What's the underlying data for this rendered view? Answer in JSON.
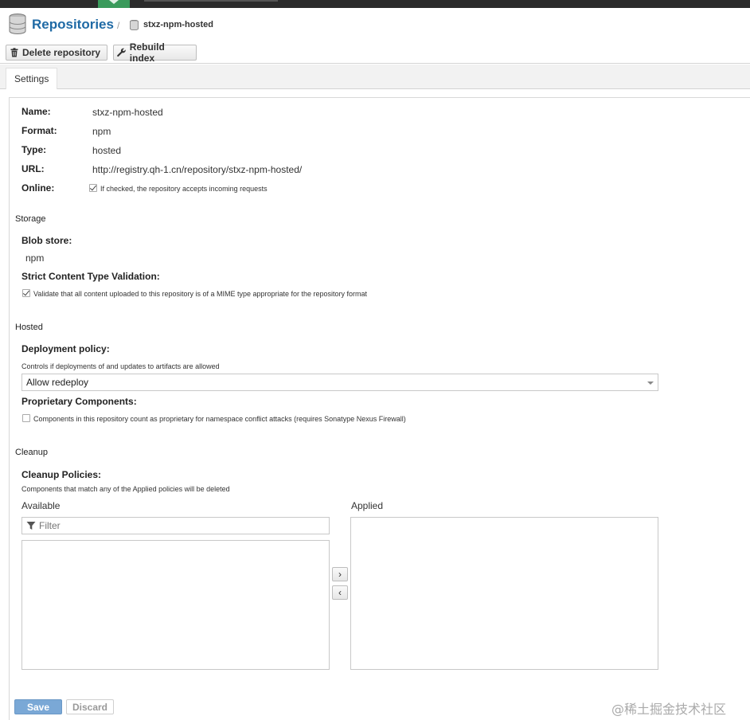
{
  "header": {
    "title": "Repositories",
    "separator": "/",
    "crumb": "stxz-npm-hosted"
  },
  "toolbar": {
    "delete_label": "Delete repository",
    "rebuild_label": "Rebuild index"
  },
  "tabs": [
    {
      "label": "Settings"
    }
  ],
  "settings": {
    "name_label": "Name:",
    "name_value": "stxz-npm-hosted",
    "format_label": "Format:",
    "format_value": "npm",
    "type_label": "Type:",
    "type_value": "hosted",
    "url_label": "URL:",
    "url_value": "http://registry.qh-1.cn/repository/stxz-npm-hosted/",
    "online_label": "Online:",
    "online_checked": true,
    "online_help": "If checked, the repository accepts incoming requests"
  },
  "storage": {
    "section": "Storage",
    "blob_label": "Blob store:",
    "blob_value": "npm",
    "strict_label": "Strict Content Type Validation:",
    "strict_checked": true,
    "strict_help": "Validate that all content uploaded to this repository is of a MIME type appropriate for the repository format"
  },
  "hosted": {
    "section": "Hosted",
    "deploy_label": "Deployment policy:",
    "deploy_help": "Controls if deployments of and updates to artifacts are allowed",
    "deploy_value": "Allow redeploy",
    "proprietary_label": "Proprietary Components:",
    "proprietary_checked": false,
    "proprietary_help": "Components in this repository count as proprietary for namespace conflict attacks (requires Sonatype Nexus Firewall)"
  },
  "cleanup": {
    "section": "Cleanup",
    "policies_label": "Cleanup Policies:",
    "policies_help": "Components that match any of the Applied policies will be deleted",
    "available_label": "Available",
    "applied_label": "Applied",
    "filter_placeholder": "Filter",
    "move_right": "›",
    "move_left": "‹"
  },
  "footer": {
    "save_label": "Save",
    "discard_label": "Discard"
  },
  "watermark": "@稀土掘金技术社区",
  "colors": {
    "title_blue": "#1f6aa5",
    "save_blue": "#7aa8d6",
    "topbar": "#2b2b2b",
    "tab_green": "#3a9a5b"
  },
  "icons": {
    "repositories": "database-icon",
    "crumb": "database-icon",
    "delete": "trash-icon",
    "rebuild": "wrench-icon",
    "filter": "filter-icon"
  }
}
